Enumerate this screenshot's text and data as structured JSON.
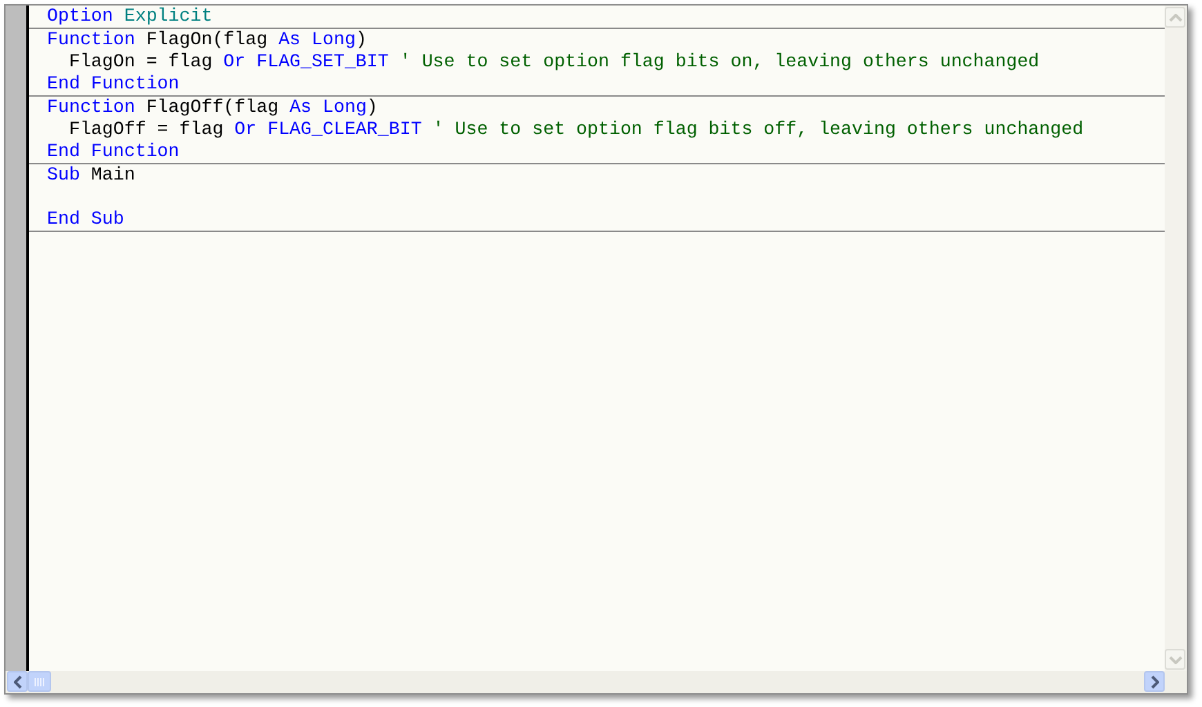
{
  "editor": {
    "procedures": [
      {
        "lines": [
          {
            "tokens": [
              {
                "text": "Option",
                "kind": "keyword"
              },
              {
                "text": " Explicit",
                "kind": "option"
              }
            ]
          }
        ]
      },
      {
        "lines": [
          {
            "tokens": [
              {
                "text": "Function",
                "kind": "keyword"
              },
              {
                "text": " FlagOn(flag ",
                "kind": "plain"
              },
              {
                "text": "As Long",
                "kind": "keyword"
              },
              {
                "text": ")",
                "kind": "plain"
              }
            ]
          },
          {
            "tokens": [
              {
                "text": "  FlagOn = flag ",
                "kind": "plain"
              },
              {
                "text": "Or FLAG_SET_BIT",
                "kind": "keyword"
              },
              {
                "text": " ' Use to set option flag bits on, leaving others unchanged",
                "kind": "comment"
              }
            ]
          },
          {
            "tokens": [
              {
                "text": "End Function",
                "kind": "keyword"
              }
            ]
          }
        ]
      },
      {
        "lines": [
          {
            "tokens": [
              {
                "text": "Function",
                "kind": "keyword"
              },
              {
                "text": " FlagOff(flag ",
                "kind": "plain"
              },
              {
                "text": "As Long",
                "kind": "keyword"
              },
              {
                "text": ")",
                "kind": "plain"
              }
            ]
          },
          {
            "tokens": [
              {
                "text": "  FlagOff = flag ",
                "kind": "plain"
              },
              {
                "text": "Or FLAG_CLEAR_BIT",
                "kind": "keyword"
              },
              {
                "text": " ' Use to set option flag bits off, leaving others unchanged",
                "kind": "comment"
              }
            ]
          },
          {
            "tokens": [
              {
                "text": "End Function",
                "kind": "keyword"
              }
            ]
          }
        ]
      },
      {
        "lines": [
          {
            "tokens": [
              {
                "text": "Sub",
                "kind": "keyword"
              },
              {
                "text": " Main",
                "kind": "plain"
              }
            ]
          },
          {
            "kind": "blank"
          },
          {
            "tokens": [
              {
                "text": "End Sub",
                "kind": "keyword"
              }
            ]
          }
        ]
      }
    ]
  }
}
